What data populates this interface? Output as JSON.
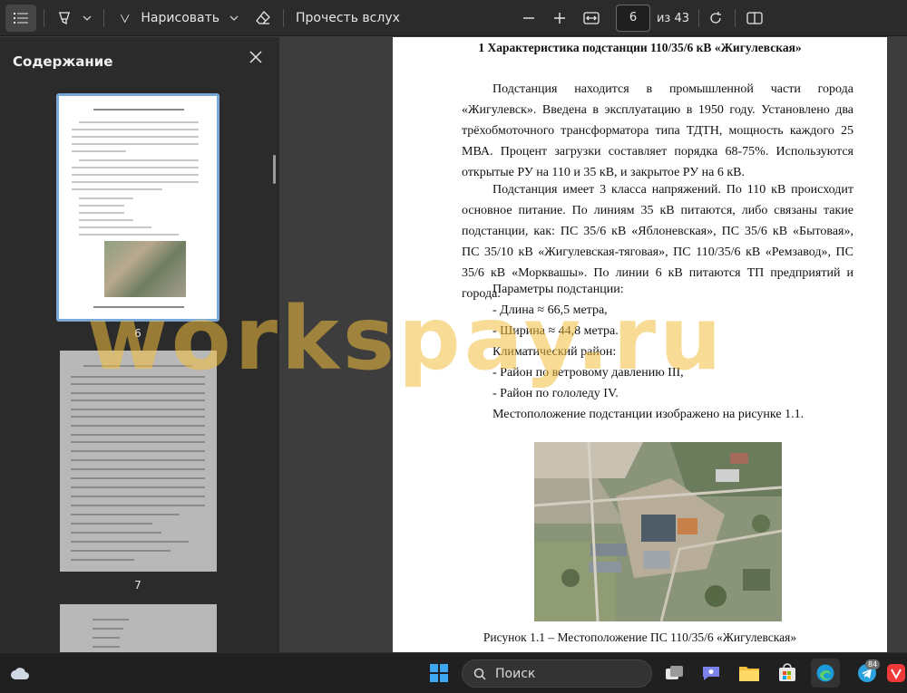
{
  "toolbar": {
    "draw_label": "Нарисовать",
    "read_aloud_label": "Прочесть вслух",
    "page_number": "6",
    "page_total": "из 43"
  },
  "sidebar": {
    "title": "Содержание",
    "thumbnails": [
      {
        "label": "6"
      },
      {
        "label": "7"
      }
    ]
  },
  "document": {
    "heading": "1 Характеристика подстанции 110/35/6 кВ «Жигулевская»",
    "paragraph1": "Подстанция находится в промышленной части города «Жигулевск». Введена в эксплуатацию в 1950 году. Установлено два трёхобмоточного трансформатора типа ТДТН, мощность каждого 25 МВА. Процент загрузки составляет порядка 68-75%. Используются открытые РУ на 110 и 35 кВ, и закрытое РУ на 6 кВ.",
    "paragraph2": "Подстанция имеет 3 класса напряжений. По 110 кВ происходит основное питание. По линиям 35 кВ питаются, либо связаны такие подстанции, как: ПС 35/6 кВ «Яблоневская», ПС 35/6 кВ «Бытовая», ПС 35/10 кВ «Жигулевская-тяговая», ПС 110/35/6 кВ «Ремзавод», ПС 35/6 кВ «Морквашы». По линии 6 кВ питаются ТП предприятий и города.",
    "lines": [
      "Параметры подстанции:",
      "- Длина ≈ 66,5 метра,",
      "- Ширина ≈ 44,8 метра.",
      "Климатический район:",
      "- Район по ветровому давлению III,",
      "- Район по гололеду IV.",
      "Местоположение подстанции изображено на рисунке 1.1."
    ],
    "caption": "Рисунок 1.1 – Местоположение ПС 110/35/6 «Жигулевская»"
  },
  "watermark": "workspay.ru",
  "taskbar": {
    "search_label": "Поиск",
    "telegram_badge": "84"
  },
  "colors": {
    "accent": "#7aa9d8",
    "watermark": "#f2be3c"
  }
}
